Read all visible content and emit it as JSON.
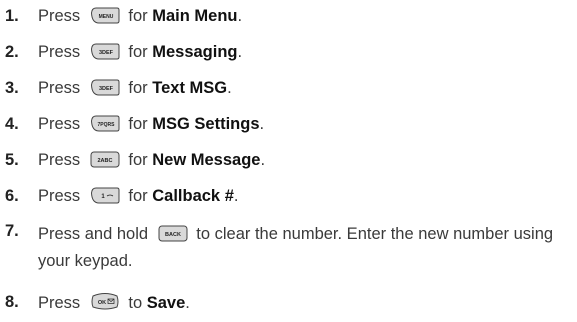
{
  "steps": [
    {
      "num": "1.",
      "pre": "Press",
      "key": "MENU",
      "key_shape": "left",
      "mid": "for",
      "bold": "Main Menu",
      "post": "."
    },
    {
      "num": "2.",
      "pre": "Press",
      "key": "3DEF",
      "key_shape": "left",
      "mid": "for",
      "bold": "Messaging",
      "post": "."
    },
    {
      "num": "3.",
      "pre": "Press",
      "key": "3DEF",
      "key_shape": "left",
      "mid": "for",
      "bold": "Text MSG",
      "post": "."
    },
    {
      "num": "4.",
      "pre": "Press",
      "key": "7PQRS",
      "key_shape": "left",
      "mid": "for",
      "bold": "MSG Settings",
      "post": "."
    },
    {
      "num": "5.",
      "pre": "Press",
      "key": "2ABC",
      "key_shape": "rect",
      "mid": "for",
      "bold": "New Message",
      "post": "."
    },
    {
      "num": "6.",
      "pre": "Press",
      "key": "1",
      "key_shape": "left",
      "mid": "for",
      "bold": "Callback #",
      "post": "."
    },
    {
      "num": "7.",
      "pre": "Press and hold",
      "key": "BACK",
      "key_shape": "rect",
      "mid": "to clear the number. Enter the new number using your keypad.",
      "bold": "",
      "post": ""
    },
    {
      "num": "8.",
      "pre": "Press",
      "key": "OK",
      "key_shape": "round",
      "mid": "to",
      "bold": "Save",
      "post": "."
    }
  ]
}
